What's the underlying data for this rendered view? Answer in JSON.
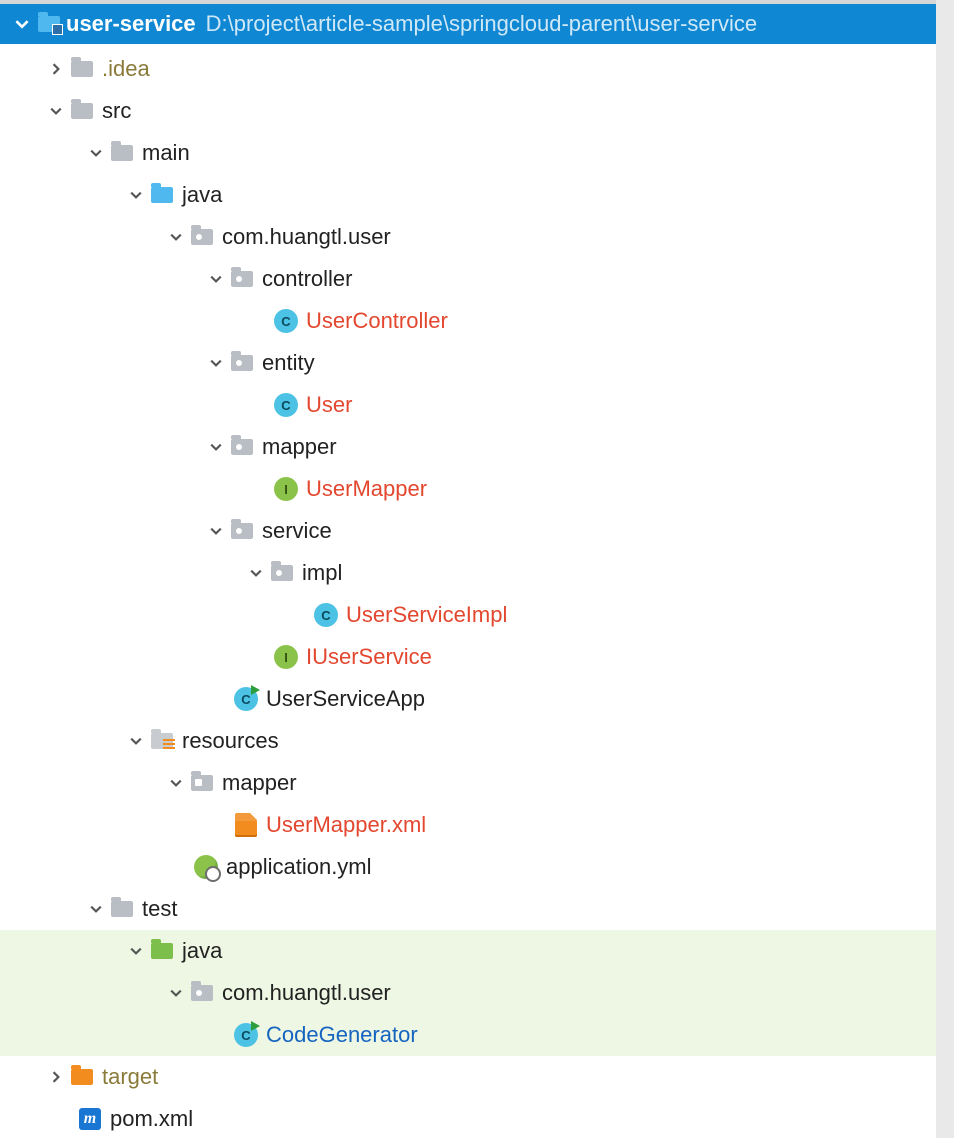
{
  "header": {
    "module_name": "user-service",
    "module_path": "D:\\project\\article-sample\\springcloud-parent\\user-service"
  },
  "tree": {
    "idea": ".idea",
    "src": "src",
    "main": "main",
    "java": "java",
    "pkg_main": "com.huangtl.user",
    "controller": "controller",
    "user_controller": "UserController",
    "entity": "entity",
    "user": "User",
    "mapper": "mapper",
    "user_mapper": "UserMapper",
    "service": "service",
    "impl": "impl",
    "user_service_impl": "UserServiceImpl",
    "iuser_service": "IUserService",
    "user_service_app": "UserServiceApp",
    "resources": "resources",
    "res_mapper": "mapper",
    "user_mapper_xml": "UserMapper.xml",
    "application_yml": "application.yml",
    "test": "test",
    "test_java": "java",
    "pkg_test": "com.huangtl.user",
    "code_generator": "CodeGenerator",
    "target": "target",
    "pom": "pom.xml"
  },
  "layout": {
    "base_indent": 44,
    "step": 40
  }
}
